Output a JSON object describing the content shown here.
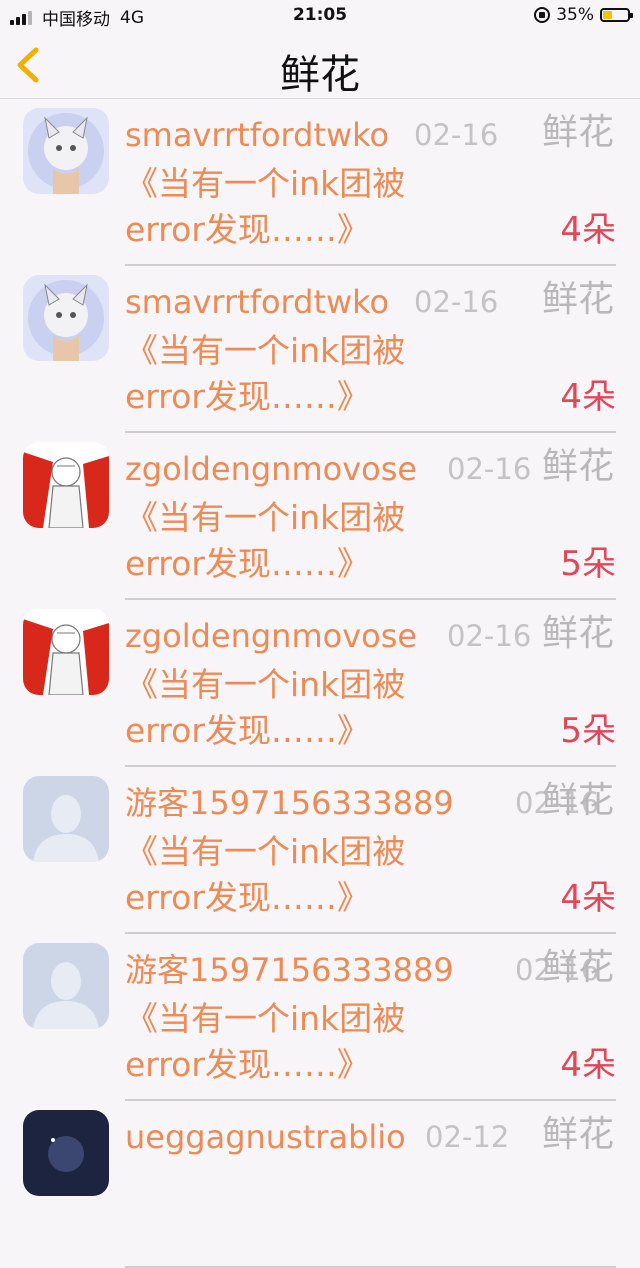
{
  "status_bar": {
    "carrier": "中国移动",
    "network": "4G",
    "time": "21:05",
    "battery": "35%",
    "battery_level": 0.35
  },
  "nav": {
    "title": "鲜花",
    "back_icon": "chevron-left-icon",
    "back_color": "#f0b000"
  },
  "list": [
    {
      "username": "smavrrtfordtwko",
      "date": "02-16",
      "type": "鲜花",
      "message": "《当有一个ink团被error发现……》",
      "count": "4朵",
      "avatar": "anime-wolf-avatar"
    },
    {
      "username": "smavrrtfordtwko",
      "date": "02-16",
      "type": "鲜花",
      "message": "《当有一个ink团被error发现……》",
      "count": "4朵",
      "avatar": "anime-wolf-avatar"
    },
    {
      "username": "zgoldengnmovose",
      "date": "02-16",
      "type": "鲜花",
      "message": "《当有一个ink团被error发现……》",
      "count": "5朵",
      "avatar": "anime-red-avatar"
    },
    {
      "username": "zgoldengnmovose",
      "date": "02-16",
      "type": "鲜花",
      "message": "《当有一个ink团被error发现……》",
      "count": "5朵",
      "avatar": "anime-red-avatar"
    },
    {
      "username": "游客1597156333889",
      "date": "02-16",
      "type": "鲜花",
      "message": "《当有一个ink团被error发现……》",
      "count": "4朵",
      "avatar": "default-user-avatar"
    },
    {
      "username": "游客1597156333889",
      "date": "02-16",
      "type": "鲜花",
      "message": "《当有一个ink团被error发现……》",
      "count": "4朵",
      "avatar": "default-user-avatar"
    },
    {
      "username": "ueggagnustrablio",
      "date": "02-12",
      "type": "鲜花",
      "message": "",
      "count": "",
      "avatar": "anime-dark-avatar"
    }
  ],
  "colors": {
    "username": "#ec8b55",
    "count": "#e04858",
    "meta": "#c4c2c5",
    "background": "#f7f5f8"
  }
}
